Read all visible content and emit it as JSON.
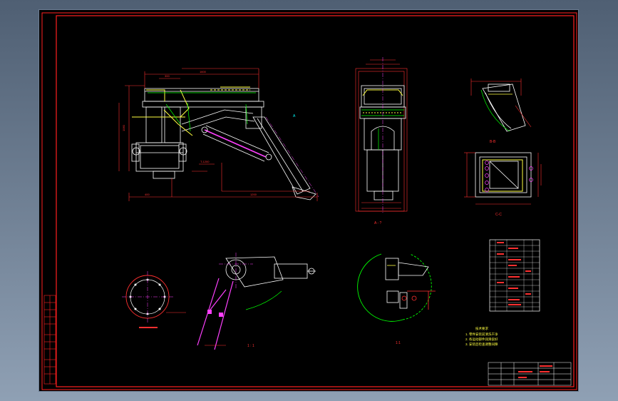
{
  "drawing": {
    "views": {
      "section_a_label": "A",
      "view_a_caption": "A - ?",
      "view_b_caption": "B-B",
      "view_c_caption": "C-C",
      "detail_caption_1": "1 : 1",
      "detail_caption_2": "1:1"
    },
    "tech_requirements": {
      "title": "技术要求",
      "items": [
        "1. 零件安装前清洗干净",
        "2. 各运动部件润滑良好",
        "3. 安装后检查调整间隙"
      ]
    },
    "colors": {
      "frame": "#ff2020",
      "geometry": "#ffffff",
      "dimension": "#ff3030",
      "centerline": "#ff40ff",
      "hatch": "#00ff00",
      "accent": "#ffff40",
      "text": "#00ffff"
    }
  }
}
